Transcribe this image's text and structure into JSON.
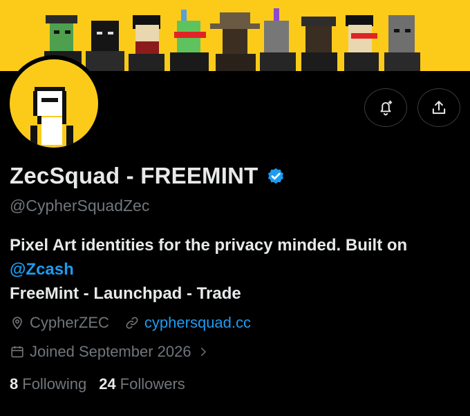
{
  "profile": {
    "display_name": "ZecSquad - FREEMINT",
    "handle": "@CypherSquadZec",
    "bio_text": "Pixel Art identities for the privacy minded. Built on ",
    "bio_mention": "@Zcash",
    "bio_line2": "FreeMint - Launchpad - Trade",
    "location": "CypherZEC",
    "website": "cyphersquad.cc",
    "joined": "Joined September 2026",
    "following_count": "8",
    "following_label": "Following",
    "followers_count": "24",
    "followers_label": "Followers"
  },
  "actions": {
    "notify_icon": "bell-plus-icon",
    "share_icon": "share-icon"
  },
  "colors": {
    "banner": "#fccb1a",
    "accent": "#1d9bf0",
    "muted": "#71767b",
    "text": "#e7e9ea"
  }
}
